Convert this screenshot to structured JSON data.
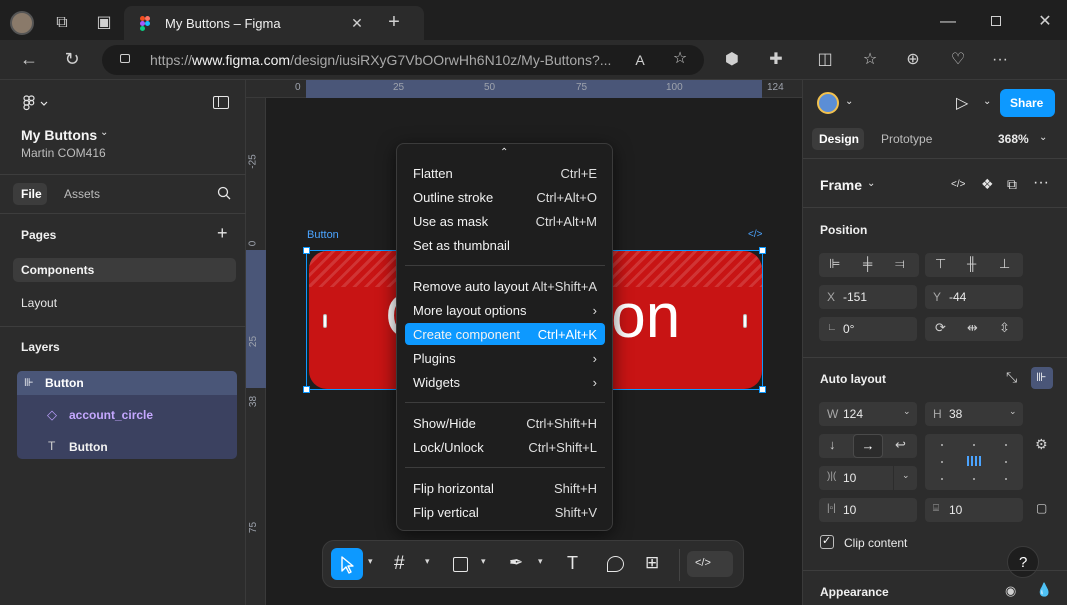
{
  "browser": {
    "tab_title": "My Buttons – Figma",
    "url_prefix": "https://",
    "url_domain": "www.figma.com",
    "url_path": "/design/iusiRXyG7VbOOrwHh6N10z/My-Buttons?..."
  },
  "file": {
    "name": "My Buttons",
    "team": "Martin COM416"
  },
  "left_panel": {
    "tabs": [
      "File",
      "Assets"
    ],
    "pages_heading": "Pages",
    "pages": [
      "Components",
      "Layout"
    ],
    "layers_heading": "Layers",
    "layers": [
      {
        "name": "Button",
        "type": "frame"
      },
      {
        "name": "account_circle",
        "type": "component"
      },
      {
        "name": "Button",
        "type": "text"
      }
    ]
  },
  "canvas": {
    "ruler_top": [
      "0",
      "25",
      "50",
      "75",
      "100",
      "124"
    ],
    "ruler_left": [
      "-25",
      "0",
      "25",
      "38",
      "75"
    ],
    "frame_label": "Button",
    "button_text_left": "C",
    "button_text_right": "ton"
  },
  "context_menu": {
    "groups": [
      [
        {
          "label": "Flatten",
          "shortcut": "Ctrl+E"
        },
        {
          "label": "Outline stroke",
          "shortcut": "Ctrl+Alt+O"
        },
        {
          "label": "Use as mask",
          "shortcut": "Ctrl+Alt+M"
        },
        {
          "label": "Set as thumbnail",
          "shortcut": ""
        }
      ],
      [
        {
          "label": "Remove auto layout",
          "shortcut": "Alt+Shift+A"
        },
        {
          "label": "More layout options",
          "shortcut": "›"
        },
        {
          "label": "Create component",
          "shortcut": "Ctrl+Alt+K"
        },
        {
          "label": "Plugins",
          "shortcut": "›"
        },
        {
          "label": "Widgets",
          "shortcut": "›"
        }
      ],
      [
        {
          "label": "Show/Hide",
          "shortcut": "Ctrl+Shift+H"
        },
        {
          "label": "Lock/Unlock",
          "shortcut": "Ctrl+Shift+L"
        }
      ],
      [
        {
          "label": "Flip horizontal",
          "shortcut": "Shift+H"
        },
        {
          "label": "Flip vertical",
          "shortcut": "Shift+V"
        }
      ]
    ]
  },
  "right_panel": {
    "share_label": "Share",
    "tabs": [
      "Design",
      "Prototype"
    ],
    "zoom": "368%",
    "frame_label": "Frame",
    "position_heading": "Position",
    "x_label": "X",
    "x_value": "-151",
    "y_label": "Y",
    "y_value": "-44",
    "rotation_value": "0°",
    "auto_layout_heading": "Auto layout",
    "w_label": "W",
    "w_value": "124",
    "h_label": "H",
    "h_value": "38",
    "gap_value": "10",
    "padding_h_value": "10",
    "padding_v_value": "10",
    "clip_content_label": "Clip content",
    "appearance_heading": "Appearance",
    "help_label": "?"
  },
  "colors": {
    "accent": "#0d99ff",
    "button_fill": "#c81414",
    "layer_selected": "#4a5678"
  }
}
